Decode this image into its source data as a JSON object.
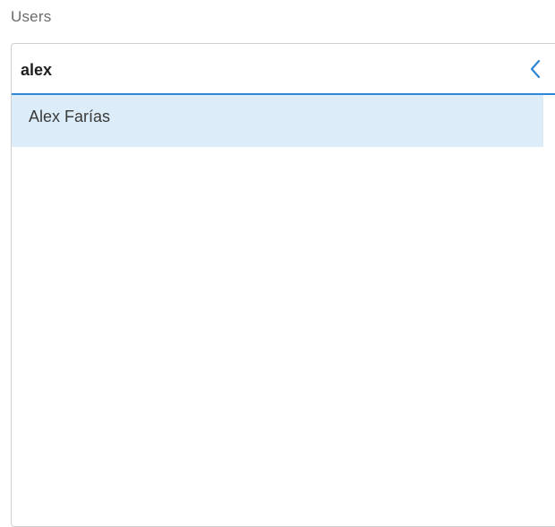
{
  "field": {
    "label": "Users"
  },
  "search": {
    "value": "alex",
    "placeholder": ""
  },
  "toggle": {
    "icon": "chevron-left-icon"
  },
  "results": [
    {
      "label": "Alex Farías",
      "highlighted": true
    }
  ],
  "colors": {
    "accent": "#2f86d4",
    "highlight": "#dcedf9",
    "label_text": "#6b6b6b",
    "border": "#cfcfcf"
  }
}
